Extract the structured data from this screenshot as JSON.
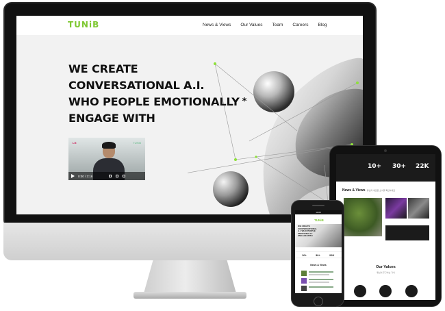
{
  "desktop": {
    "logo": "TUNiB",
    "nav": [
      "News & Views",
      "Our Values",
      "Team",
      "Careers",
      "Blog"
    ],
    "hero": {
      "line1": "WE CREATE",
      "line2": "CONVERSATIONAL A.I.",
      "line3_prefix": "WHO PEOPLE ",
      "line3_highlight": "EMOTIONALLY",
      "asterisk": "*",
      "line4": "ENGAGE WITH"
    },
    "video": {
      "time": "0:00 / 3:16",
      "brand_left": "LG",
      "brand_right": "TUNiB"
    }
  },
  "tablet": {
    "stats": [
      "10+",
      "30+",
      "22K"
    ],
    "news_title": "News & Views",
    "news_subtitle": "튜닙의 새로운 소식을 확인하세요",
    "values_title": "Our Values",
    "values_subtitle": "튜닙이 추구하는 가치"
  },
  "phone": {
    "logo": "TUNiB",
    "status": "10:05",
    "hero_text": "WE CREATE CONVERSATIONAL A.I. WHO PEOPLE EMOTIONALLY ENGAGE WITH",
    "stats": [
      "10+",
      "30+",
      "22K"
    ],
    "news_title": "News & Views"
  },
  "colors": {
    "accent": "#7ec832",
    "highlight": "#8ee03a",
    "dark": "#111111"
  }
}
